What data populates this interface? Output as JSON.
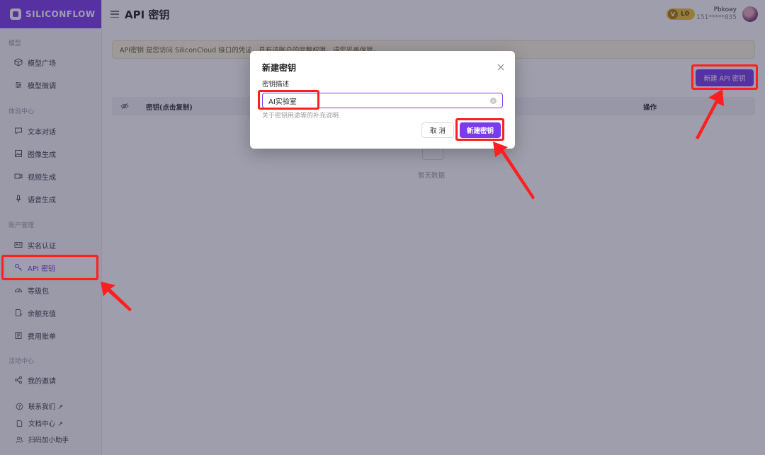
{
  "sidebar": {
    "logo": "SILICONFLOW",
    "sections": {
      "models": "模型",
      "experience": "体验中心",
      "account": "账户管理",
      "activity": "活动中心"
    },
    "items": {
      "model_square": "模型广场",
      "model_finetune": "模型微调",
      "text_chat": "文本对话",
      "image_gen": "图像生成",
      "video_gen": "视频生成",
      "audio_gen": "语音生成",
      "realname": "实名认证",
      "api_key": "API 密钥",
      "level_pack": "等级包",
      "recharge": "余额充值",
      "billing": "费用账单",
      "invite": "我的邀请"
    },
    "footer": {
      "contact": "联系我们 ↗",
      "docs": "文档中心 ↗",
      "assistant": "扫码加小助手"
    }
  },
  "header": {
    "title": "API 密钥",
    "level_badge": "L0",
    "level_v": "V",
    "user_name": "Pbkoay",
    "user_phone": "151*****835"
  },
  "main": {
    "notice": "API密钥 是您访问 SiliconCloud 接口的凭证，具有该账户的完整权限，请您妥善保管。",
    "new_key_button": "新建 API 密钥",
    "table": {
      "col_key": "密钥(点击复制)",
      "col_ops": "操作"
    },
    "empty_text": "暂无数据"
  },
  "modal": {
    "title": "新建密钥",
    "field_label": "密钥描述",
    "field_value": "AI实验室",
    "field_hint": "关于密钥用途等的补充说明",
    "cancel": "取 消",
    "submit": "新建密钥"
  },
  "colors": {
    "brand": "#7c3aed",
    "annotation": "#ff1f1f"
  }
}
